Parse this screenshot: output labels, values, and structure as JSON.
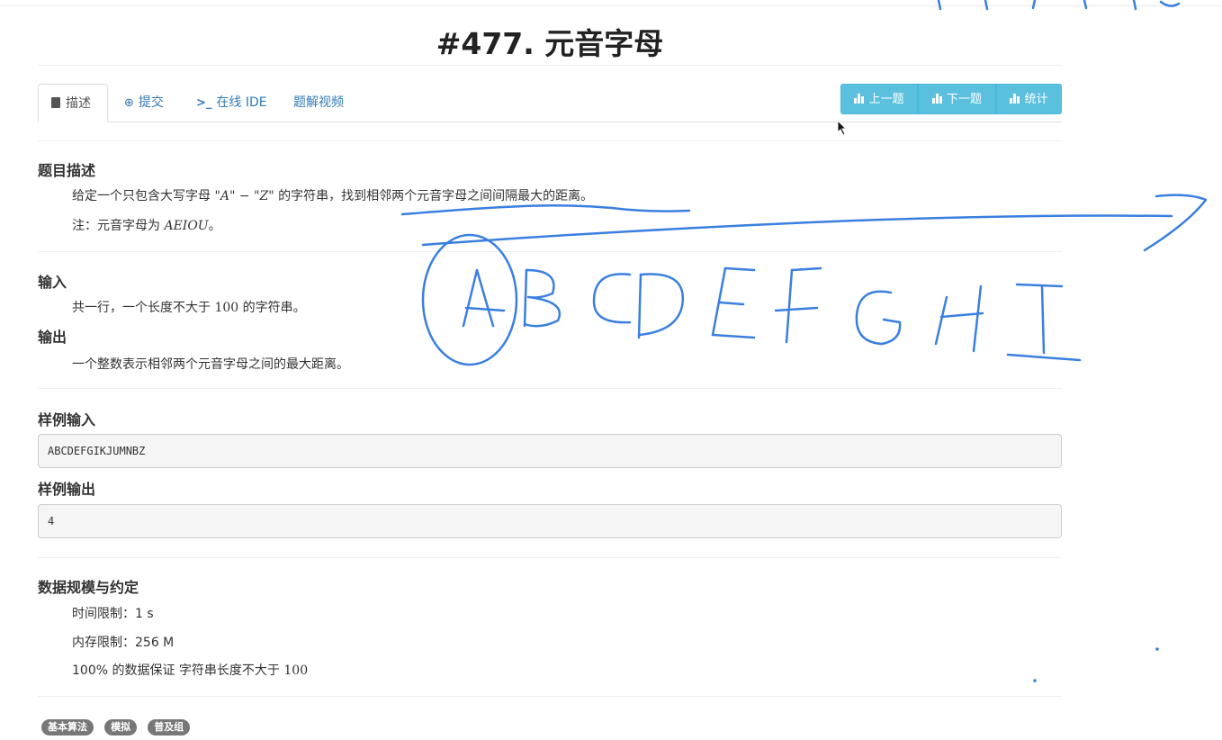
{
  "problem": {
    "title": "#477. 元音字母"
  },
  "tabs": [
    {
      "label": "描述",
      "icon": "book-icon"
    },
    {
      "label": "提交",
      "icon": "arrow-circle-icon"
    },
    {
      "label": "在线 IDE",
      "icon": "terminal-icon"
    },
    {
      "label": "题解视频",
      "icon": ""
    }
  ],
  "nav_buttons": {
    "prev": "上一题",
    "next": "下一题",
    "stats": "统计"
  },
  "description": {
    "heading": "题目描述",
    "line1_pre": "给定一个只包含大写字母",
    "line1_math": "\"A\" − \"Z\"",
    "line1_post": "的字符串，找到相邻两个元音字母之间间隔最大的距离。",
    "line2_pre": "注：元音字母为",
    "line2_math": "AEIOU",
    "line2_post": "。"
  },
  "input": {
    "heading": "输入",
    "text_pre": "共一行，一个长度不大于",
    "text_num": "100",
    "text_post": "的字符串。"
  },
  "output": {
    "heading": "输出",
    "text": "一个整数表示相邻两个元音字母之间的最大距离。"
  },
  "sample_input": {
    "heading": "样例输入",
    "value": "ABCDEFGIKJUMNBZ"
  },
  "sample_output": {
    "heading": "样例输出",
    "value": "4"
  },
  "limits": {
    "heading": "数据规模与约定",
    "time": "时间限制：1 s",
    "memory": "内存限制：256 M",
    "guarantee_pre": "100% 的数据保证 字符串长度不大于",
    "guarantee_num": "100"
  },
  "tags": [
    "基本算法",
    "模拟",
    "普及组"
  ],
  "colors": {
    "accent": "#5bc0de",
    "link": "#337ab7",
    "ink": "#3a7fe0",
    "tag": "#777777"
  }
}
